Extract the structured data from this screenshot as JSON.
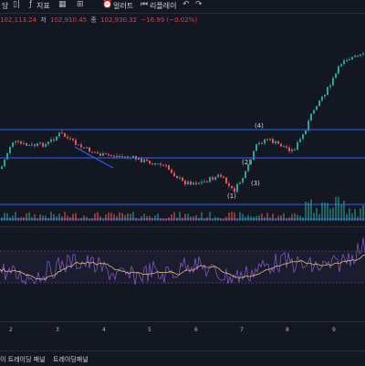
{
  "toolbar": {
    "interval_label": "당",
    "indicators_label": "지표",
    "alert_label": "얼러트",
    "replay_label": "리플레이"
  },
  "ohlc": {
    "high": "102,113.24",
    "low_label": "저",
    "low": "102,910.45",
    "close_label": "종",
    "close": "102,930.32",
    "change": "−16.99 (−0.02%)"
  },
  "wave_labels": [
    "(1)",
    "(2)",
    "(3)",
    "(4)"
  ],
  "x_axis_ticks": [
    "2",
    "3",
    "4",
    "5",
    "6",
    "7",
    "8",
    "9"
  ],
  "bottom_tabs": [
    "이 트레이딩 패널",
    "트레이딩패널"
  ],
  "colors": {
    "background": "#131722",
    "bull": "#26a69a",
    "bear": "#ef5350",
    "hline": "#2962ff",
    "rsi": "#7e57c2",
    "rsi_ma": "#e0c060"
  },
  "chart_data": {
    "type": "candlestick",
    "horizontal_levels": [
      "support/resistance",
      "support/resistance",
      "support/resistance",
      "support/resistance"
    ],
    "indicator_panes": [
      "volume",
      "oscillator"
    ]
  }
}
